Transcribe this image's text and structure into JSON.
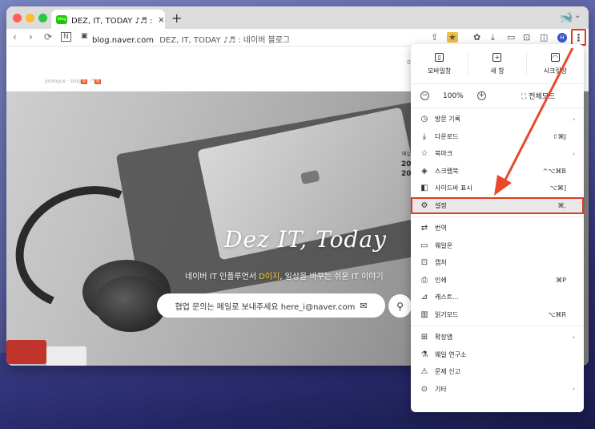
{
  "tab": {
    "favicon_text": "blog",
    "title": "DEZ, IT, TODAY ♪♬ : 네이버",
    "close": "×",
    "new_tab": "+"
  },
  "toolbar": {
    "back": "‹",
    "forward": "›",
    "reload": "⟳",
    "n_icon": "N",
    "lock": "🔒",
    "url_host": "blog.naver.com",
    "url_title": "DEZ, IT, TODAY ♪♬ : 네이버 블로그",
    "profile_initial": "H",
    "menu_icon": "⋮"
  },
  "page": {
    "nav_prologue": "prologue",
    "nav_blog": "blog",
    "nav_it": "IT",
    "hero_title": "Dez IT, Today",
    "hero_sub_prefix": "네이버 IT 인플루언서 ",
    "hero_sub_highlight": "D이지",
    "hero_sub_suffix": ", 일상을 바꾸는 쉬운 IT 이야기",
    "contact_text": "협업 문의는 메일로 보내주세요 here_i@naver.com",
    "mail_icon": "✉",
    "search_icon": "⚲",
    "side_small": "메일",
    "side_line1": "20",
    "side_line2": "20",
    "top_right": "이"
  },
  "menu": {
    "top": [
      {
        "label": "모바일창",
        "icon": "▯"
      },
      {
        "label": "새 창",
        "icon": "+"
      },
      {
        "label": "시크릿창",
        "icon": "◠"
      }
    ],
    "zoom_minus": "−",
    "zoom_value": "100%",
    "zoom_plus": "+",
    "fullscreen": "⛶ 전체모드",
    "section1": [
      {
        "icon": "◷",
        "label": "방문 기록",
        "shortcut": "",
        "arrow": "›"
      },
      {
        "icon": "⤓",
        "label": "다운로드",
        "shortcut": "⇧⌘J",
        "arrow": ""
      },
      {
        "icon": "☆",
        "label": "북마크",
        "shortcut": "",
        "arrow": "›"
      },
      {
        "icon": "◈",
        "label": "스크랩북",
        "shortcut": "^⌥⌘B",
        "arrow": ""
      },
      {
        "icon": "◧",
        "label": "사이드바 표시",
        "shortcut": "⌥⌘]",
        "arrow": ""
      },
      {
        "icon": "⚙",
        "label": "설정",
        "shortcut": "⌘,",
        "arrow": ""
      }
    ],
    "section2": [
      {
        "icon": "⇄",
        "label": "번역",
        "shortcut": "",
        "arrow": ""
      },
      {
        "icon": "▭",
        "label": "웨일온",
        "shortcut": "",
        "arrow": ""
      },
      {
        "icon": "⊡",
        "label": "캡처",
        "shortcut": "",
        "arrow": ""
      },
      {
        "icon": "⎙",
        "label": "인쇄",
        "shortcut": "⌘P",
        "arrow": ""
      },
      {
        "icon": "⊿",
        "label": "캐스트...",
        "shortcut": "",
        "arrow": ""
      },
      {
        "icon": "▥",
        "label": "읽기모드",
        "shortcut": "⌥⌘R",
        "arrow": ""
      }
    ],
    "section3": [
      {
        "icon": "⊞",
        "label": "확장앱",
        "shortcut": "",
        "arrow": "›"
      },
      {
        "icon": "⚗",
        "label": "웨일 연구소",
        "shortcut": "",
        "arrow": ""
      },
      {
        "icon": "⚠",
        "label": "문제 신고",
        "shortcut": "",
        "arrow": ""
      },
      {
        "icon": "⊙",
        "label": "기타",
        "shortcut": "",
        "arrow": "›"
      }
    ]
  },
  "colors": {
    "highlight_red": "#e03a22",
    "arrow_red": "#e8492c"
  }
}
